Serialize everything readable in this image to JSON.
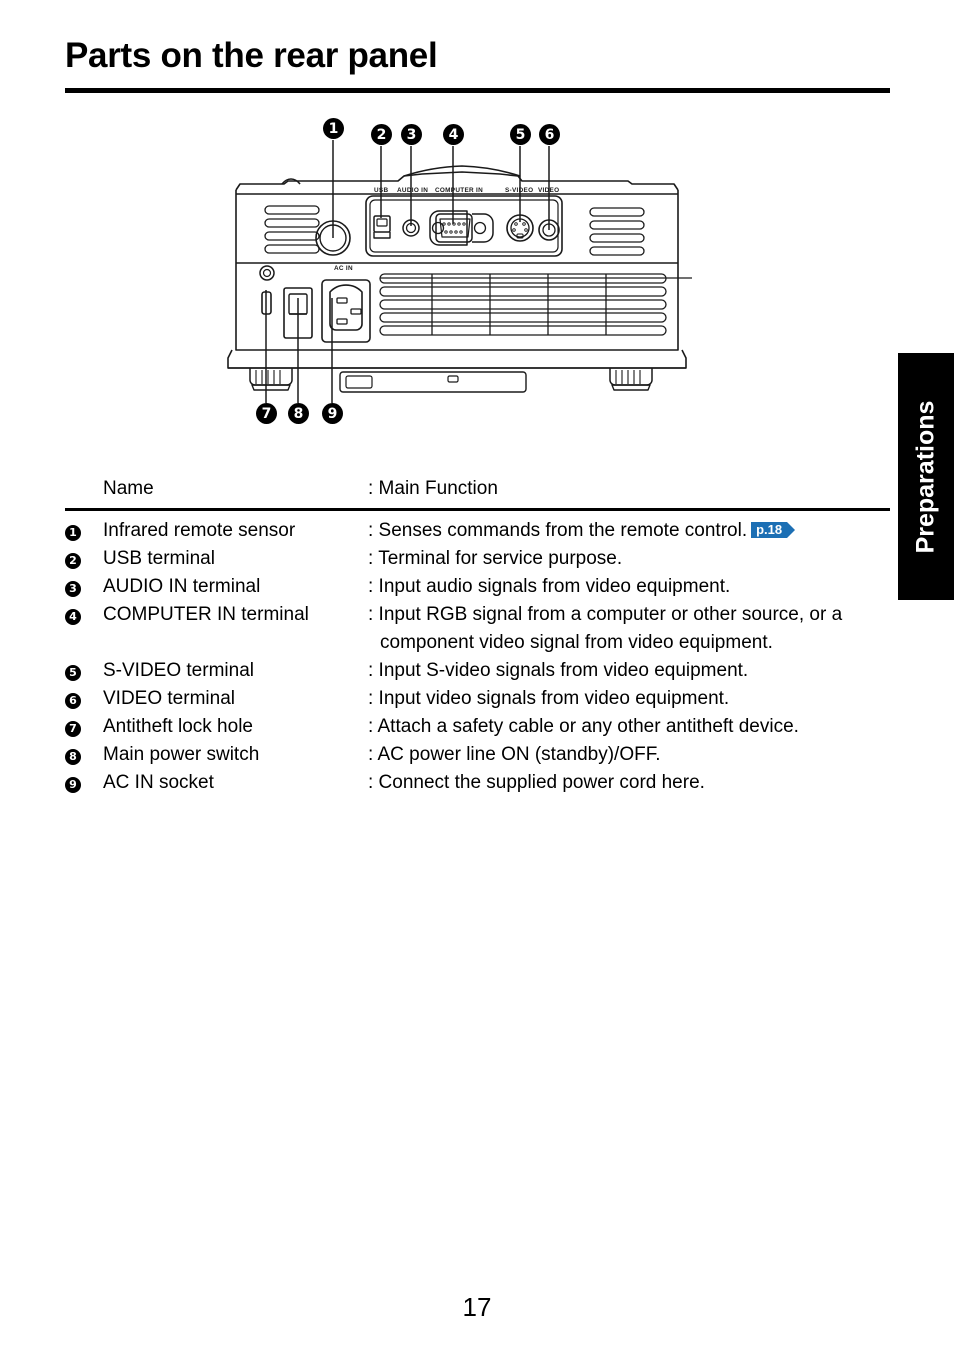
{
  "document": {
    "title": "Parts on the rear panel",
    "page_number": "17",
    "side_tab": "Preparations"
  },
  "table": {
    "header": {
      "name": "Name",
      "function": ": Main Function"
    },
    "rows": [
      {
        "num": "1",
        "name": "Infrared remote sensor",
        "function": ": Senses commands from the remote control.",
        "function2": "",
        "badge": "p.18"
      },
      {
        "num": "2",
        "name": "USB terminal",
        "function": ": Terminal for service purpose.",
        "function2": "",
        "badge": ""
      },
      {
        "num": "3",
        "name": "AUDIO IN terminal",
        "function": ": Input audio signals from video equipment.",
        "function2": "",
        "badge": ""
      },
      {
        "num": "4",
        "name": "COMPUTER IN terminal",
        "function": ": Input RGB signal from a computer or other source, or a",
        "function2": "component video signal from video equipment.",
        "badge": ""
      },
      {
        "num": "5",
        "name": "S-VIDEO terminal",
        "function": ": Input S-video signals from video equipment.",
        "function2": "",
        "badge": ""
      },
      {
        "num": "6",
        "name": "VIDEO terminal",
        "function": ": Input video signals from video equipment.",
        "function2": "",
        "badge": ""
      },
      {
        "num": "7",
        "name": "Antitheft lock hole",
        "function": ": Attach a safety cable or any other antitheft device.",
        "function2": "",
        "badge": ""
      },
      {
        "num": "8",
        "name": "Main power switch",
        "function": ": AC power line ON (standby)/OFF.",
        "function2": "",
        "badge": ""
      },
      {
        "num": "9",
        "name": "AC IN socket",
        "function": ": Connect the supplied power cord here.",
        "function2": "",
        "badge": ""
      }
    ]
  },
  "diagram": {
    "callouts_top": [
      "1",
      "2",
      "3",
      "4",
      "5",
      "6"
    ],
    "callouts_bottom": [
      "7",
      "8",
      "9"
    ],
    "panel_labels": {
      "usb": "USB",
      "audio_in": "AUDIO IN",
      "computer_in": "COMPUTER IN",
      "s_video": "S-VIDEO",
      "video": "VIDEO",
      "ac_in": "AC IN"
    }
  },
  "colors": {
    "badge_blue": "#1c6fb4",
    "ink": "#000000",
    "paper": "#ffffff"
  }
}
